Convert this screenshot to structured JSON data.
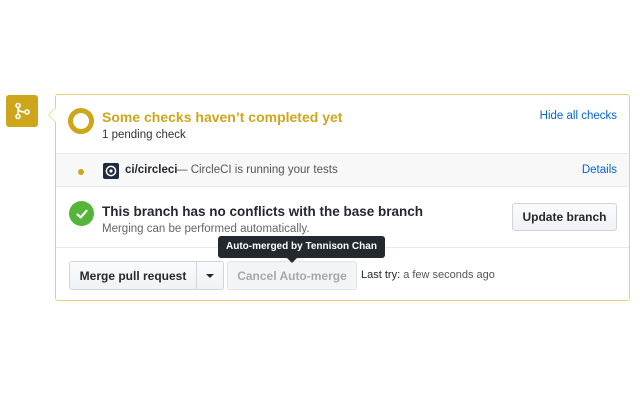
{
  "merge_badge": {
    "icon": "git-merge-icon",
    "color": "#cea61b"
  },
  "checks": {
    "title": "Some checks haven’t completed yet",
    "subtitle": "1 pending check",
    "hide_link": "Hide all checks",
    "status_color": "#cea61b",
    "items": [
      {
        "icon": "circleci-logo-icon",
        "name": "ci/circleci",
        "description": "— CircleCI is running your tests",
        "details_label": "Details",
        "status": "pending"
      }
    ]
  },
  "conflicts": {
    "icon": "check-circle-icon",
    "title": "This branch has no conflicts with the base branch",
    "subtitle": "Merging can be performed automatically.",
    "update_button": "Update branch",
    "success_color": "#55b539"
  },
  "merge": {
    "merge_button": "Merge pull request",
    "dropdown_icon": "caret-down-icon",
    "cancel_button": "Cancel Auto-merge",
    "last_try_label": "Last try:",
    "last_try_value": "a few seconds ago",
    "tooltip": "Auto-merged by Tennison Chan"
  },
  "colors": {
    "link": "#0366d6",
    "border": "#e9cf7a"
  }
}
